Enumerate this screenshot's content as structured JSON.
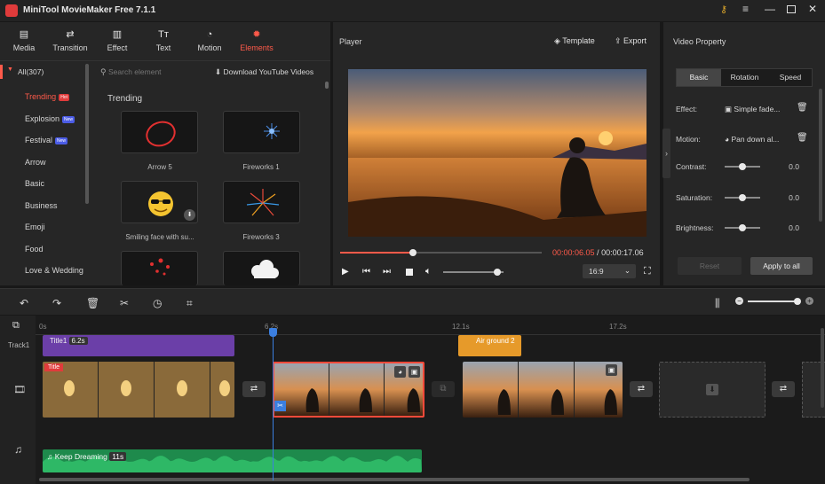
{
  "app": {
    "title": "MiniTool MovieMaker Free 7.1.1"
  },
  "toolbar": {
    "items": [
      {
        "label": "Media",
        "icon": "media-icon"
      },
      {
        "label": "Transition",
        "icon": "transition-icon"
      },
      {
        "label": "Effect",
        "icon": "effect-icon"
      },
      {
        "label": "Text",
        "icon": "text-icon"
      },
      {
        "label": "Motion",
        "icon": "motion-icon"
      },
      {
        "label": "Elements",
        "icon": "elements-icon",
        "active": true
      }
    ]
  },
  "sidebar": {
    "all_label": "All(307)",
    "items": [
      {
        "label": "Trending",
        "badge": "Hot",
        "active": true
      },
      {
        "label": "Explosion",
        "badge": "New"
      },
      {
        "label": "Festival",
        "badge": "New"
      },
      {
        "label": "Arrow"
      },
      {
        "label": "Basic"
      },
      {
        "label": "Business"
      },
      {
        "label": "Emoji"
      },
      {
        "label": "Food"
      },
      {
        "label": "Love & Wedding"
      }
    ]
  },
  "elements": {
    "search_placeholder": "Search element",
    "download_label": "Download YouTube Videos",
    "section_title": "Trending",
    "cards": [
      {
        "label": "Arrow 5"
      },
      {
        "label": "Fireworks 1"
      },
      {
        "label": "Smiling face with su..."
      },
      {
        "label": "Fireworks 3"
      }
    ]
  },
  "player": {
    "title": "Player",
    "template_label": "Template",
    "export_label": "Export",
    "current_time": "00:00:06.05",
    "separator": " / ",
    "total_time": "00:00:17.06",
    "progress": 0.36,
    "volume": 0.9,
    "aspect": "16:9"
  },
  "video_property": {
    "title": "Video Property",
    "tabs": [
      "Basic",
      "Rotation",
      "Speed"
    ],
    "active_tab": "Basic",
    "effect_label": "Effect:",
    "effect_value": "Simple fade...",
    "motion_label": "Motion:",
    "motion_value": "Pan down al...",
    "contrast_label": "Contrast:",
    "contrast_value": "0.0",
    "saturation_label": "Saturation:",
    "saturation_value": "0.0",
    "brightness_label": "Brightness:",
    "brightness_value": "0.0",
    "reset_label": "Reset",
    "apply_label": "Apply to all"
  },
  "timeline": {
    "ruler": [
      "0s",
      "6.2s",
      "12.1s",
      "17.2s"
    ],
    "playhead_label": "6.2s",
    "track1_label": "Track1",
    "text_clip": {
      "title": "Title1",
      "duration": "6.2s"
    },
    "element_clip": "Air ground 2",
    "title_tag": "Title",
    "audio": {
      "name": "Keep Dreaming",
      "duration": "11s"
    }
  },
  "colors": {
    "accent": "#ff5a4a",
    "purple": "#6b3fa8",
    "orange": "#e69a2a",
    "audio": "#1e8a4c",
    "blue": "#3b7fe0"
  }
}
